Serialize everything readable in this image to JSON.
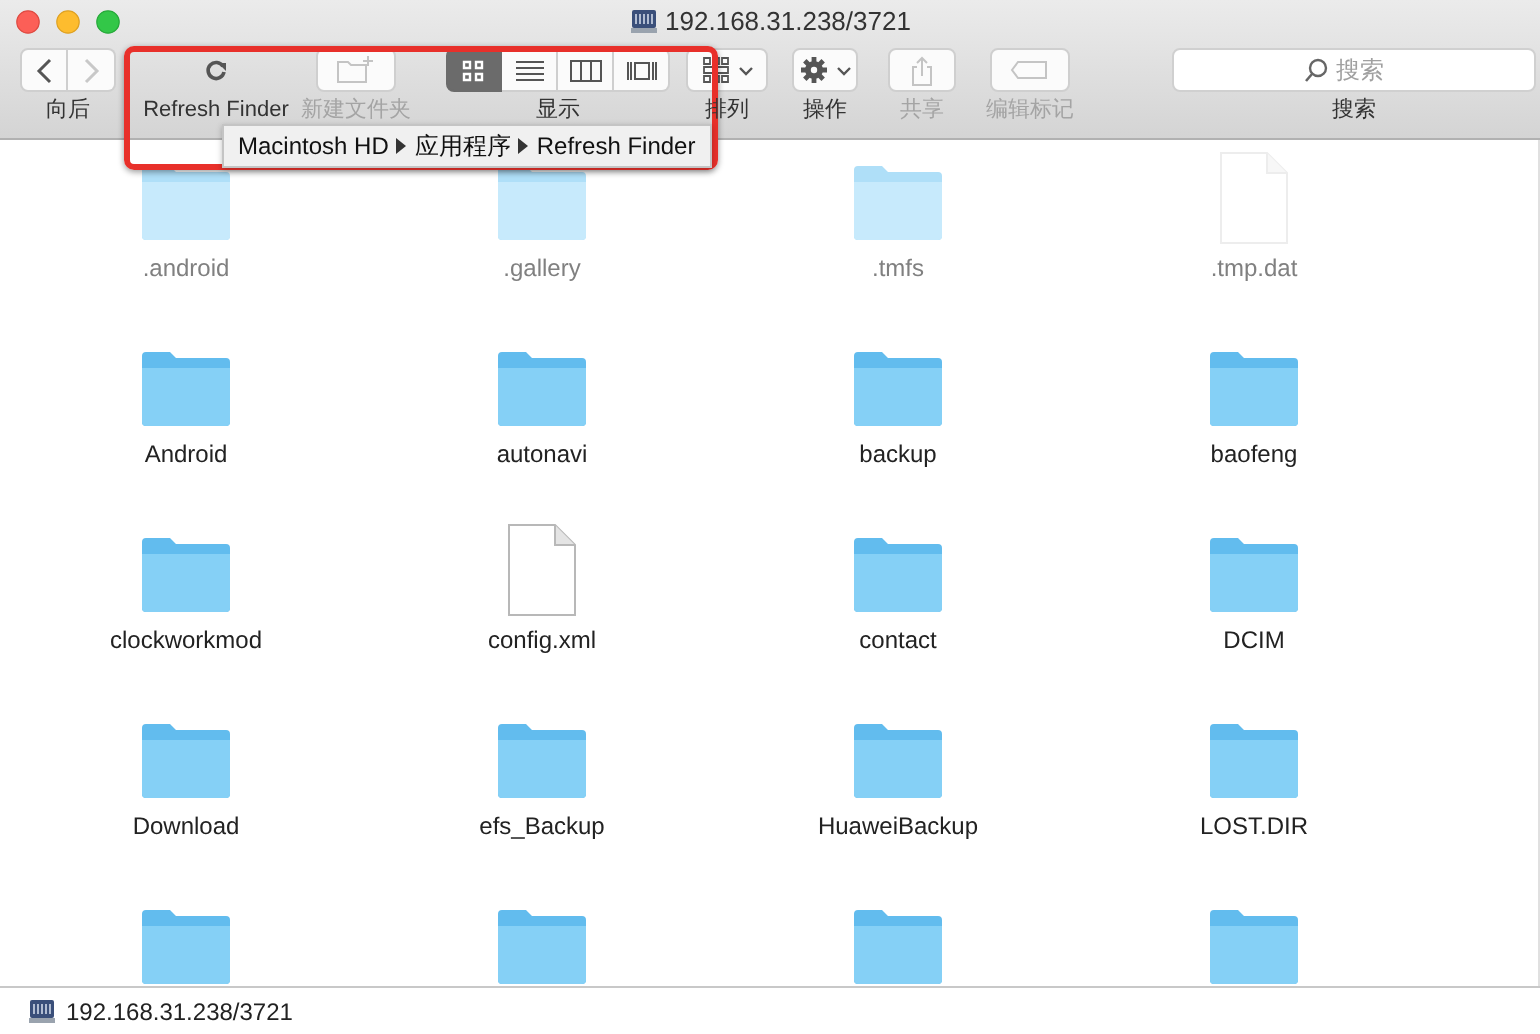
{
  "window": {
    "title": "192.168.31.238/3721"
  },
  "toolbar": {
    "items": [
      {
        "kind": "nav",
        "label": "向后",
        "buttons": [
          {
            "kind": "back",
            "disabled": false
          },
          {
            "kind": "forward",
            "disabled": true
          }
        ]
      },
      {
        "kind": "refresh",
        "label": "Refresh Finder",
        "disabled": false
      },
      {
        "kind": "newfolder",
        "label": "新建文件夹",
        "disabled": true
      },
      {
        "kind": "view",
        "label": "显示",
        "modes": [
          {
            "kind": "icon",
            "selected": true
          },
          {
            "kind": "list",
            "selected": false
          },
          {
            "kind": "column",
            "selected": false
          },
          {
            "kind": "cover",
            "selected": false
          }
        ]
      },
      {
        "kind": "arrange",
        "label": "排列",
        "disabled": false
      },
      {
        "kind": "action",
        "label": "操作",
        "disabled": false
      },
      {
        "kind": "share",
        "label": "共享",
        "disabled": true
      },
      {
        "kind": "tags",
        "label": "编辑标记",
        "disabled": true
      },
      {
        "kind": "search",
        "label": "搜索",
        "placeholder": "搜索"
      }
    ]
  },
  "tooltip": {
    "path": [
      "Macintosh HD",
      "应用程序",
      "Refresh Finder"
    ]
  },
  "highlight_frame": true,
  "files": [
    {
      "name": ".android",
      "kind": "folder",
      "hidden": true
    },
    {
      "name": ".gallery",
      "kind": "folder",
      "hidden": true
    },
    {
      "name": ".tmfs",
      "kind": "folder",
      "hidden": true
    },
    {
      "name": ".tmp.dat",
      "kind": "file",
      "hidden": true
    },
    {
      "name": "Android",
      "kind": "folder",
      "hidden": false
    },
    {
      "name": "autonavi",
      "kind": "folder",
      "hidden": false
    },
    {
      "name": "backup",
      "kind": "folder",
      "hidden": false
    },
    {
      "name": "baofeng",
      "kind": "folder",
      "hidden": false
    },
    {
      "name": "clockworkmod",
      "kind": "folder",
      "hidden": false
    },
    {
      "name": "config.xml",
      "kind": "file",
      "hidden": false
    },
    {
      "name": "contact",
      "kind": "folder",
      "hidden": false
    },
    {
      "name": "DCIM",
      "kind": "folder",
      "hidden": false
    },
    {
      "name": "Download",
      "kind": "folder",
      "hidden": false
    },
    {
      "name": "efs_Backup",
      "kind": "folder",
      "hidden": false
    },
    {
      "name": "HuaweiBackup",
      "kind": "folder",
      "hidden": false
    },
    {
      "name": "LOST.DIR",
      "kind": "folder",
      "hidden": false
    },
    {
      "kind": "folder",
      "hidden": false
    },
    {
      "kind": "folder",
      "hidden": false
    },
    {
      "kind": "folder",
      "hidden": false
    },
    {
      "kind": "folder",
      "hidden": false
    }
  ],
  "status_bar": {
    "text": "192.168.31.238/3721"
  }
}
